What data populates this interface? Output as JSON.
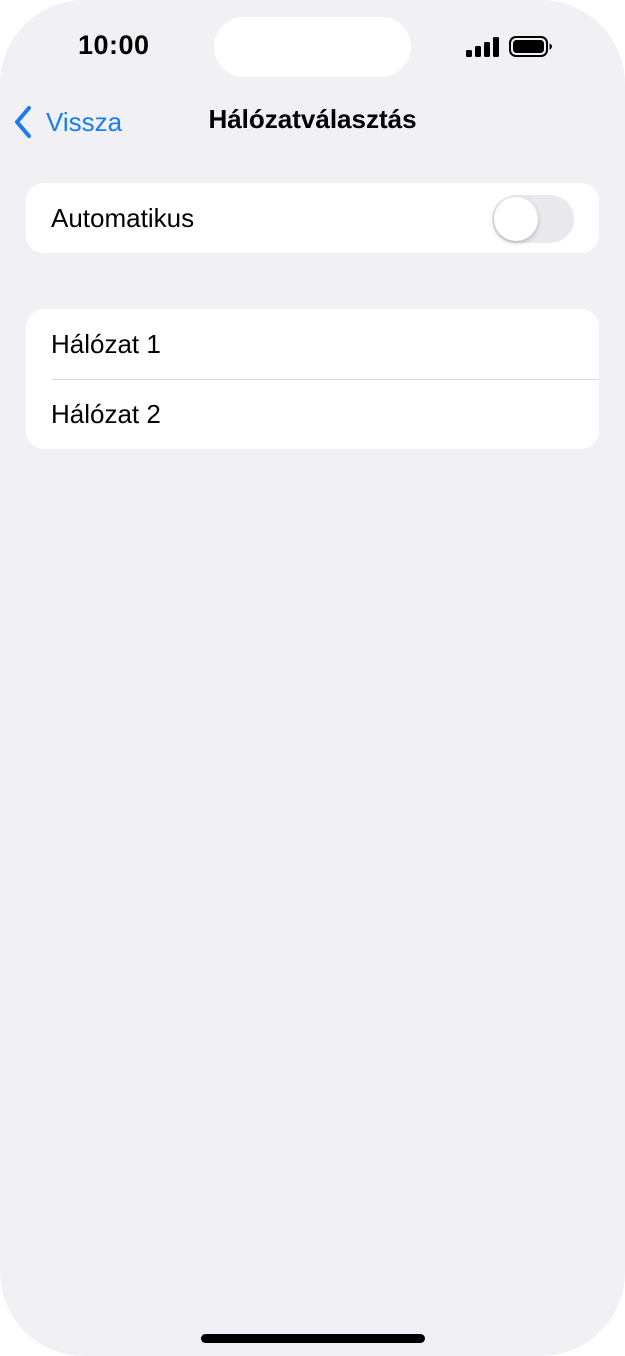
{
  "status_bar": {
    "time": "10:00",
    "signal_icon": "cellular-signal-icon",
    "battery_icon": "battery-full-icon"
  },
  "nav": {
    "back_label": "Vissza",
    "back_icon": "chevron-left-icon",
    "title": "Hálózatválasztás"
  },
  "automatic": {
    "label": "Automatikus",
    "enabled": false
  },
  "networks": [
    {
      "label": "Hálózat 1"
    },
    {
      "label": "Hálózat 2"
    }
  ],
  "colors": {
    "accent": "#1a7cf0",
    "background": "#f0f0f5",
    "toggle_off": "#e8e8ed"
  }
}
